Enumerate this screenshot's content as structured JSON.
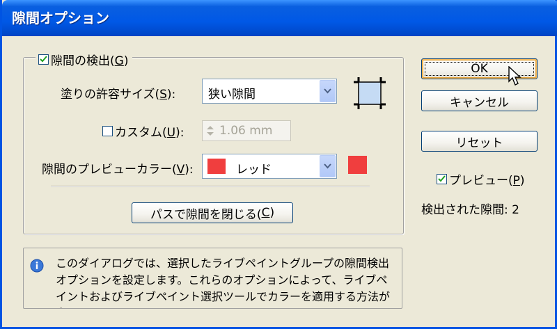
{
  "window": {
    "title": "隙間オプション"
  },
  "group": {
    "detect_label": "隙間の検出(",
    "detect_mnemonic": "G",
    "detect_suffix": ")",
    "detect_checked": true
  },
  "fill_size": {
    "label": "塗りの許容サイズ(",
    "mnemonic": "S",
    "suffix": "):",
    "value": "狭い隙間"
  },
  "custom": {
    "label": "カスタム(",
    "mnemonic": "U",
    "suffix": "):",
    "checked": false,
    "value": "1.06 mm"
  },
  "preview_color": {
    "label": "隙間のプレビューカラー(",
    "mnemonic": "V",
    "suffix": "):",
    "value": "レッド",
    "color": "#f03e3e"
  },
  "close_paths_button": {
    "label": "パスで隙間を閉じる(",
    "mnemonic": "C",
    "suffix": ")"
  },
  "info": {
    "text": "このダイアログでは、選択したライブペイントグループの隙間検出オプションを設定します。これらのオプションによって、ライブペイントおよびライブペイント選択ツールでカラーを適用する方法が変更され"
  },
  "buttons": {
    "ok": "OK",
    "cancel": "キャンセル",
    "reset": "リセット"
  },
  "preview": {
    "label": "プレビュー(",
    "mnemonic": "P",
    "suffix": ")",
    "checked": true
  },
  "status": {
    "label": "検出された隙間: 2"
  },
  "icons": {
    "gap-size-icon": "square-with-corner-marks",
    "info-icon": "info",
    "check-icon": "checkmark",
    "dropdown-arrow-icon": "chevron-down",
    "spinner-icon": "up-down-arrows",
    "cursor-icon": "mouse-pointer"
  }
}
